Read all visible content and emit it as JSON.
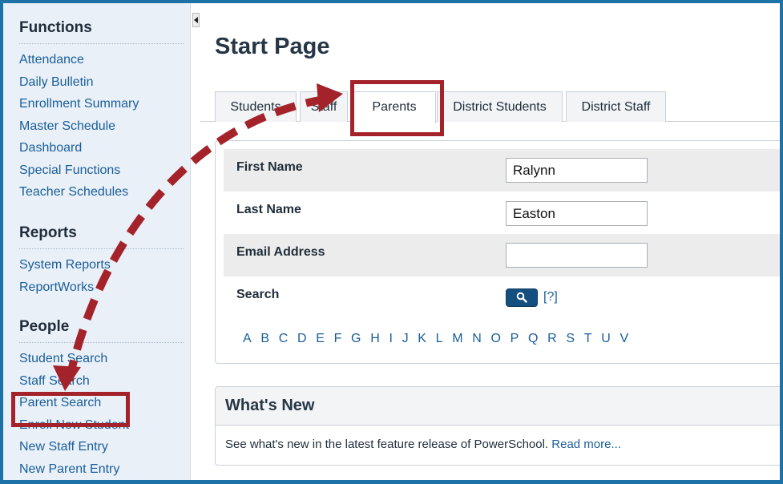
{
  "sidebar": {
    "sections": [
      {
        "title": "Functions",
        "items": [
          "Attendance",
          "Daily Bulletin",
          "Enrollment Summary",
          "Master Schedule",
          "Dashboard",
          "Special Functions",
          "Teacher Schedules"
        ]
      },
      {
        "title": "Reports",
        "items": [
          "System Reports",
          "ReportWorks"
        ]
      },
      {
        "title": "People",
        "items": [
          "Student Search",
          "Staff Search",
          "Parent Search",
          "Enroll New Student",
          "New Staff Entry",
          "New Parent Entry"
        ]
      }
    ]
  },
  "page": {
    "title": "Start Page"
  },
  "tabs": [
    "Students",
    "Staff",
    "Parents",
    "District Students",
    "District Staff"
  ],
  "active_tab": "Parents",
  "form": {
    "first_name_label": "First Name",
    "first_name_value": "Ralynn",
    "last_name_label": "Last Name",
    "last_name_value": "Easton",
    "email_label": "Email Address",
    "email_value": "",
    "search_label": "Search",
    "help_text": "[?]"
  },
  "alphabet": [
    "A",
    "B",
    "C",
    "D",
    "E",
    "F",
    "G",
    "H",
    "I",
    "J",
    "K",
    "L",
    "M",
    "N",
    "O",
    "P",
    "Q",
    "R",
    "S",
    "T",
    "U",
    "V"
  ],
  "whats_new": {
    "title": "What's New",
    "text": "See what's new in the latest feature release of PowerSchool.",
    "link": "Read more..."
  },
  "colors": {
    "frame": "#1d73a6",
    "highlight": "#a4232a",
    "link": "#1a5e99",
    "search_button": "#14507f"
  }
}
